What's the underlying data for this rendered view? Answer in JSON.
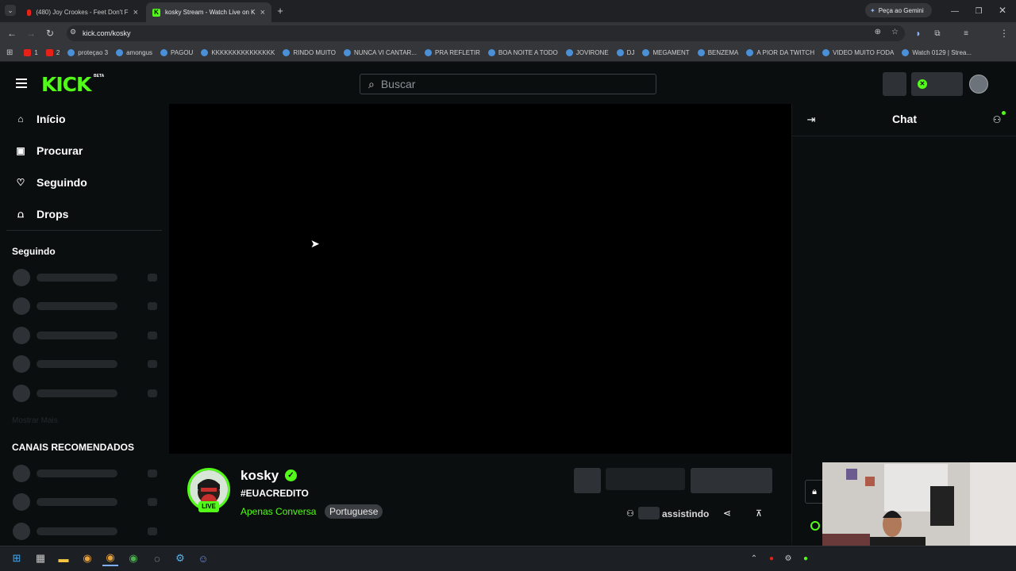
{
  "browser": {
    "tabs": [
      {
        "title": "(480) Joy Crookes - Feet Don't F",
        "active": false
      },
      {
        "title": "kosky Stream - Watch Live on K",
        "active": true
      }
    ],
    "new_tab": "+",
    "gemini_label": "Peça ao Gemini",
    "url": "kick.com/kosky",
    "bookmarks": [
      {
        "label": "1",
        "type": "youtube"
      },
      {
        "label": "2",
        "type": "youtube"
      },
      {
        "label": "proteçao 3",
        "type": "link"
      },
      {
        "label": "amongus",
        "type": "link"
      },
      {
        "label": "PAGOU",
        "type": "link"
      },
      {
        "label": "KKKKKKKKKKKKKKK",
        "type": "link"
      },
      {
        "label": "RINDO MUITO",
        "type": "link"
      },
      {
        "label": "NUNCA VI CANTAR...",
        "type": "link"
      },
      {
        "label": "PRA REFLETIR",
        "type": "link"
      },
      {
        "label": "BOA NOITE A TODO",
        "type": "link"
      },
      {
        "label": "JOVIRONE",
        "type": "link"
      },
      {
        "label": "DJ",
        "type": "link"
      },
      {
        "label": "MEGAMENT",
        "type": "link"
      },
      {
        "label": "BENZEMA",
        "type": "link"
      },
      {
        "label": "A PIOR DA TWITCH",
        "type": "link"
      },
      {
        "label": "VIDEO MUITO FODA",
        "type": "link"
      },
      {
        "label": "Watch 0129 | Strea...",
        "type": "link"
      }
    ]
  },
  "kick": {
    "logo": "KICK",
    "logo_badge": "BETA",
    "search_placeholder": "Buscar",
    "nav": [
      {
        "label": "Início",
        "icon": "home-icon"
      },
      {
        "label": "Procurar",
        "icon": "browse-icon"
      },
      {
        "label": "Seguindo",
        "icon": "heart-icon"
      },
      {
        "label": "Drops",
        "icon": "drops-icon"
      }
    ],
    "following_heading": "Seguindo",
    "show_more": "Mostrar Mais",
    "recommended_heading": "CANAIS RECOMENDADOS",
    "chat_title": "Chat",
    "channel": {
      "name": "kosky",
      "live_badge": "LIVE",
      "stream_title": "#EUACREDITO",
      "category": "Apenas Conversa",
      "language_tag": "Portuguese",
      "viewers_label": "assistindo"
    },
    "colors": {
      "accent": "#53fc18",
      "background": "#0b0e0f"
    }
  }
}
